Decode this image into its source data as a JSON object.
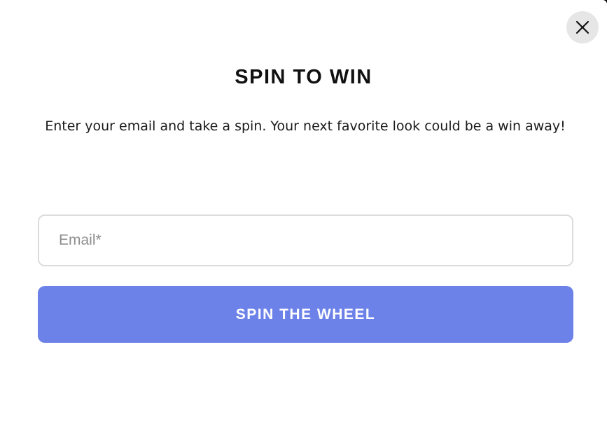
{
  "modal": {
    "title": "SPIN TO WIN",
    "subtitle": "Enter your email and take a spin. Your next favorite look could be a win away!",
    "email_placeholder": "Email*",
    "email_value": "",
    "submit_label": "SPIN THE WHEEL",
    "close_icon": "close-icon"
  },
  "colors": {
    "button_background": "#6d82e8",
    "button_text": "#ffffff",
    "close_button_background": "#e6e6e6",
    "input_border": "#dcdcdc"
  }
}
